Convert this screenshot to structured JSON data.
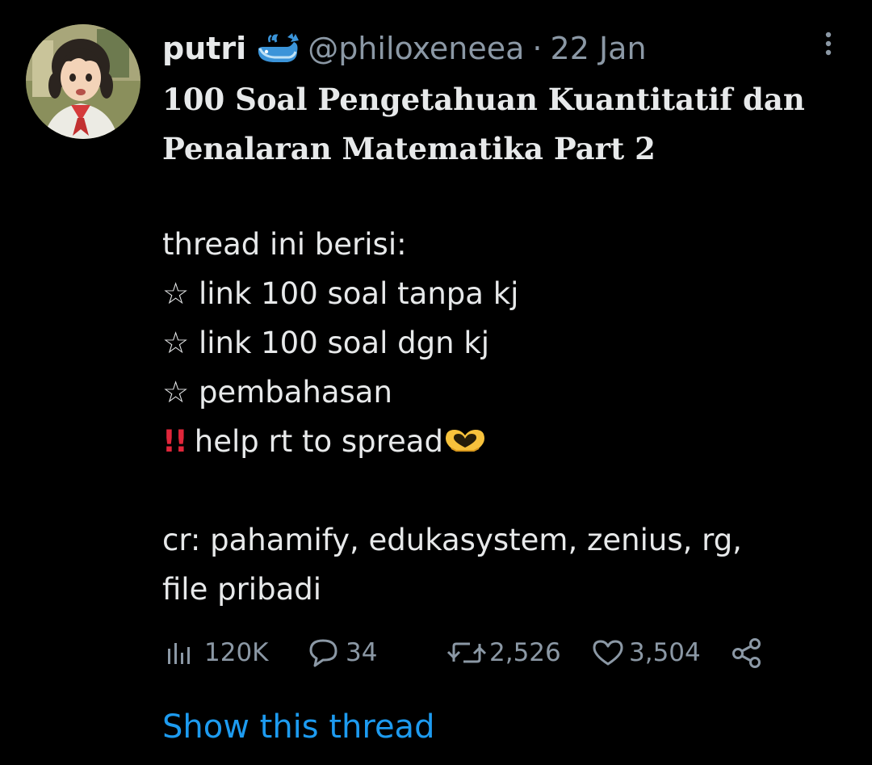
{
  "tweet": {
    "display_name": "putri",
    "handle": "@philoxeneea",
    "separator": "·",
    "date": "22 Jan",
    "headline": [
      "100 Soal Pengetahuan Kuantitatif dan",
      "Penalaran Matematika Part 2"
    ],
    "body": {
      "intro": "thread ini berisi:",
      "bullet_symbol": "☆",
      "items": [
        "link 100 soal tanpa kj",
        "link 100 soal dgn kj",
        "pembahasan"
      ],
      "alert_symbol": "!!",
      "alert_text": "help rt to spread",
      "credits": [
        "cr: pahamify, edukasystem, zenius, rg,",
        "file pribadi"
      ]
    }
  },
  "stats": {
    "views": "120K",
    "replies": "34",
    "retweets": "2,526",
    "likes": "3,504"
  },
  "show_thread_label": "Show this thread",
  "icons": {
    "verified_badge": "whale-emoji",
    "alert": "double-exclamation-emoji",
    "heart": "heart-hands-emoji",
    "views": "bar-chart-icon",
    "reply": "speech-bubble-icon",
    "retweet": "retweet-icon",
    "like": "heart-outline-icon",
    "share": "share-icon",
    "more": "vertical-dots-icon"
  },
  "colors": {
    "background": "#000000",
    "text": "#e7e9ea",
    "muted": "#8b98a5",
    "link": "#1d9bf0",
    "whale": "#3b94d9",
    "alert": "#e0263a",
    "heart_emoji": "#f7c23c"
  }
}
